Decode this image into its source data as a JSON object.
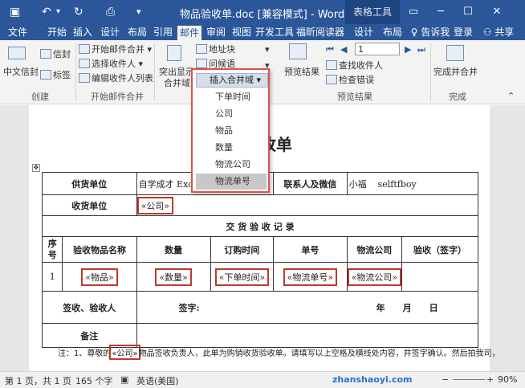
{
  "title_bar": {
    "save_icon": "save-icon",
    "undo_icon": "undo-icon",
    "redo_icon": "redo-icon",
    "print_preview_icon": "print-preview-icon",
    "qa_dropdown_icon": "qa-dropdown-icon",
    "document_title": "物品验收单.doc [兼容模式] - Word",
    "context_tab_group": "表格工具",
    "restore_ribbon_icon": "restore-ribbon-icon",
    "minimize_icon": "minimize-icon",
    "maximize_icon": "maximize-icon",
    "close_icon": "close-icon"
  },
  "menu_tabs": [
    "文件",
    "开始",
    "插入",
    "设计",
    "布局",
    "引用",
    "邮件",
    "审阅",
    "视图",
    "开发工具",
    "福昕阅读器",
    "设计",
    "布局"
  ],
  "active_tab": "邮件",
  "tell_me": "告诉我",
  "login": "登录",
  "share": "共享",
  "ribbon": {
    "create": {
      "label": "创建",
      "envelope": "中文信封",
      "letter": "信封",
      "labels": "标签"
    },
    "start_merge": {
      "label": "开始邮件合并",
      "start": "开始邮件合并",
      "select_recipients": "选择收件人",
      "edit_list": "编辑收件人列表"
    },
    "write_insert": {
      "highlight": "突出显示",
      "highlight2": "合并域",
      "address_block": "地址块",
      "greeting": "问候语",
      "insert_field": "插入合并域"
    },
    "preview": {
      "label": "预览结果",
      "preview_results": "预览结果",
      "record_value": "1",
      "find_recipient": "查找收件人",
      "check_errors": "检查错误"
    },
    "finish": {
      "label": "完成",
      "finish_merge": "完成并合并"
    }
  },
  "merge_field_dropdown": {
    "header": "插入合并域",
    "items": [
      "下单时间",
      "公司",
      "物品",
      "数量",
      "物流公司",
      "物流单号"
    ],
    "selected": "物流单号"
  },
  "document": {
    "title": "验收单",
    "supplier_label": "供货单位",
    "supplier_value": "自学成才 Excel 公司",
    "contact_label": "联系人及微信",
    "contact_name": "小福",
    "contact_wechat": "selftfboy",
    "receiver_label": "收货单位",
    "receiver_field": "«公司»",
    "section_title": "交 货 验 收 记 录",
    "headers": [
      "序号",
      "验收物品名称",
      "数量",
      "订购时间",
      "单号",
      "物流公司",
      "验收（签字）"
    ],
    "row": {
      "index": "1",
      "item": "«物品»",
      "qty": "«数量»",
      "time": "«下单时间»",
      "order_no": "«物流单号»",
      "logistics": "«物流公司»"
    },
    "sign_label": "签收、验收人",
    "sign_text": "签字:",
    "date_text": "年　　月　　日",
    "note_label": "备注",
    "footnote_prefix": "注：1、尊敬的",
    "footnote_field": "«公司»",
    "footnote_suffix": "物品签收负责人，此单为购销收货验收单。请填写以上空格及横线处内容，并签字确认。然后拍我司，"
  },
  "status": {
    "pages": "第 1 页，共 1 页",
    "words": "165 个字",
    "language": "英语(美国)",
    "zoom": "90%",
    "watermark": "zhanshaoyi.com"
  }
}
